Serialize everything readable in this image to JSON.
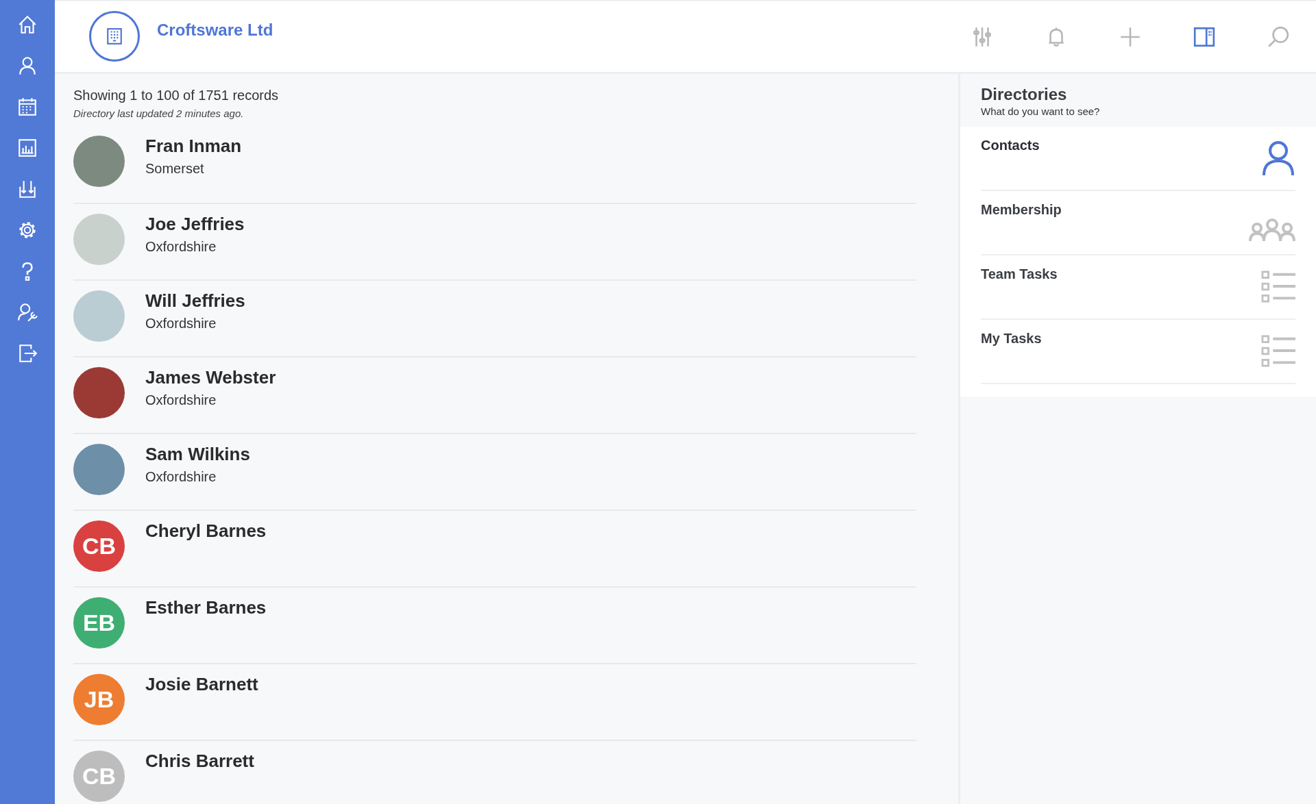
{
  "header": {
    "company": "Croftsware Ltd",
    "toolbar": [
      {
        "selected": false
      },
      {
        "selected": false
      },
      {
        "selected": false
      },
      {
        "selected": true
      },
      {
        "selected": false
      }
    ]
  },
  "summary": {
    "count": "Showing 1 to 100 of 1751 records",
    "updated": "Directory last updated 2 minutes ago."
  },
  "contacts": [
    {
      "name": "Fran Inman",
      "region": "Somerset",
      "kind": "photo"
    },
    {
      "name": "Joe Jeffries",
      "region": "Oxfordshire",
      "kind": "photo"
    },
    {
      "name": "Will Jeffries",
      "region": "Oxfordshire",
      "kind": "photo"
    },
    {
      "name": "James Webster",
      "region": "Oxfordshire",
      "kind": "photo"
    },
    {
      "name": "Sam Wilkins",
      "region": "Oxfordshire",
      "kind": "photo"
    },
    {
      "name": "Cheryl Barnes",
      "kind": "initials",
      "initials": "CB",
      "color": "#d94141"
    },
    {
      "name": "Esther Barnes",
      "kind": "initials",
      "initials": "EB",
      "color": "#3fae72"
    },
    {
      "name": "Josie Barnett",
      "kind": "initials",
      "initials": "JB",
      "color": "#ee7d31"
    },
    {
      "name": "Chris Barrett",
      "kind": "initials",
      "initials": "CB",
      "color": "#bdbdbd"
    }
  ],
  "directories": {
    "title": "Directories",
    "subtitle": "What do you want to see?",
    "items": [
      {
        "label": "Contacts",
        "kind": "person",
        "selected": true
      },
      {
        "label": "Membership",
        "kind": "group",
        "selected": false
      },
      {
        "label": "Team Tasks",
        "kind": "list",
        "selected": false
      },
      {
        "label": "My Tasks",
        "kind": "list",
        "selected": false
      }
    ]
  }
}
